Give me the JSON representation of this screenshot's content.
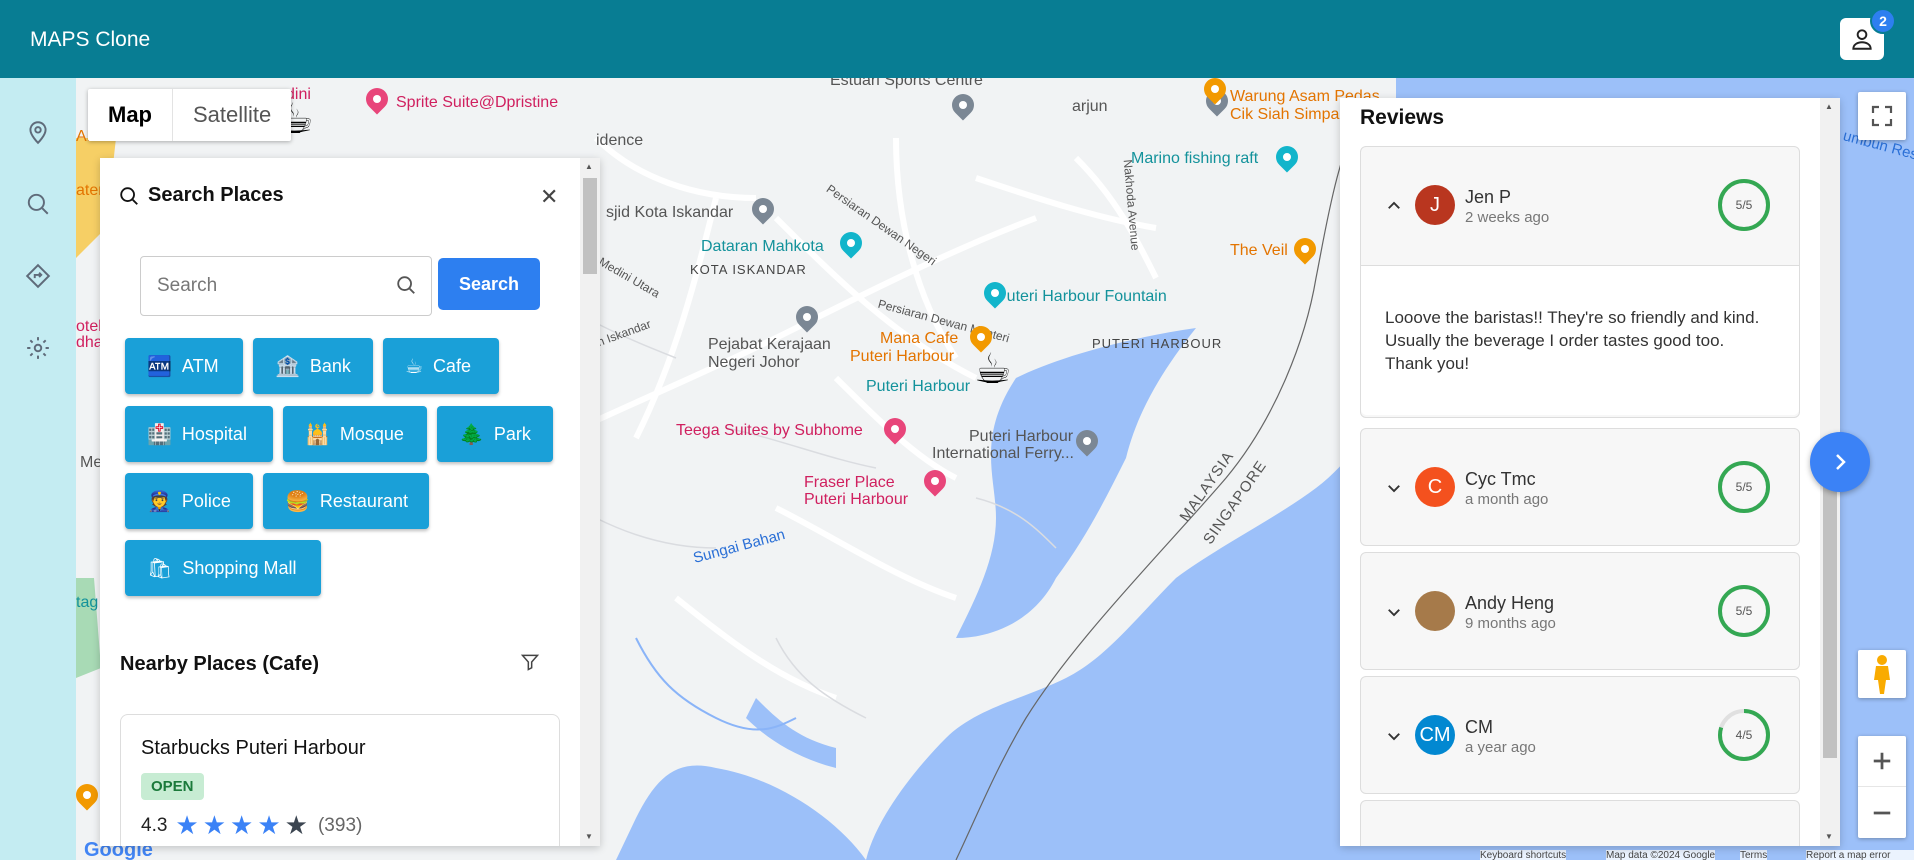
{
  "app": {
    "title": "MAPS Clone",
    "notification_count": "2"
  },
  "rail": {
    "items": [
      "location-icon",
      "search-icon",
      "directions-icon",
      "settings-icon"
    ]
  },
  "map": {
    "type_tabs": [
      "Map",
      "Satellite"
    ],
    "labels": {
      "estuari": "Estuari Sports Centre",
      "arjun": "arjun",
      "warung1": "Warung Asam Pedas",
      "warung2": "Cik Siah Simpang",
      "sprite": "Sprite Suite@Dpristine",
      "dini": "dini",
      "idence": "idence",
      "masjid": "sjid Kota Iskandar",
      "persiaran_dewan": "Persiaran Dewan Negeri",
      "nakhoda": "Nakhoda Avenue",
      "marino": "Marino fishing raft",
      "mahkota": "Dataran Mahkota",
      "kota_iskandar": "KOTA ISKANDAR",
      "medini": "h Medini Utara",
      "veil": "The Veil",
      "fountain": "Puteri Harbour Fountain",
      "persiaran_menteri": "Persiaran Dewan Menteri",
      "iskandar_road": "n Iskandar",
      "pejabat1": "Pejabat Kerajaan",
      "pejabat2": "Negeri Johor",
      "mana1": "Mana Cafe",
      "mana2": "Puteri Harbour",
      "puteri_harbour_area": "PUTERI HARBOUR",
      "puteri_harbour": "Puteri Harbour",
      "teega": "Teega Suites by Subhome",
      "ferry1": "Puteri Harbour",
      "ferry2": "International Ferry...",
      "fraser1": "Fraser Place",
      "fraser2": "Puteri Harbour",
      "malaysia": "MALAYSIA",
      "singapore": "SINGAPORE",
      "sungai": "Sungai Bahan",
      "rumbun": "umbun Rese",
      "otel": "otel",
      "dha": "dha",
      "ateri": "ateri",
      "and": "AND",
      "me": "Me",
      "tag": "tag"
    },
    "footer": [
      "Keyboard shortcuts",
      "Map data ©2024 Google",
      "Terms",
      "Report a map error"
    ],
    "brand": "Google"
  },
  "search_panel": {
    "title": "Search Places",
    "input_placeholder": "Search",
    "search_button": "Search",
    "categories": [
      {
        "label": "ATM",
        "icon": "🏧"
      },
      {
        "label": "Bank",
        "icon": "🏦"
      },
      {
        "label": "Cafe",
        "icon": "☕"
      },
      {
        "label": "Hospital",
        "icon": "🏥"
      },
      {
        "label": "Mosque",
        "icon": "🕌"
      },
      {
        "label": "Park",
        "icon": "🌲"
      },
      {
        "label": "Police",
        "icon": "👮"
      },
      {
        "label": "Restaurant",
        "icon": "🍔"
      },
      {
        "label": "Shopping Mall",
        "icon": "🛍"
      }
    ],
    "nearby_title": "Nearby Places (Cafe)",
    "place": {
      "name": "Starbucks Puteri Harbour",
      "status": "OPEN",
      "rating": "4.3",
      "stars": 4,
      "reviews": "(393)"
    }
  },
  "reviews": {
    "title": "Reviews",
    "items": [
      {
        "initial": "J",
        "name": "Jen P",
        "time": "2 weeks ago",
        "score": "5/5",
        "fraction": 1.0,
        "expanded": true,
        "text": "Looove the baristas!! They're so friendly and kind. Usually the beverage I order tastes good too. Thank you!",
        "color": "#b9361f"
      },
      {
        "initial": "C",
        "name": "Cyc Tmc",
        "time": "a month ago",
        "score": "5/5",
        "fraction": 1.0,
        "color": "#f4511e"
      },
      {
        "initial": "",
        "name": "Andy Heng",
        "time": "9 months ago",
        "score": "5/5",
        "fraction": 1.0,
        "color": "#a67a4a"
      },
      {
        "initial": "CM",
        "name": "CM",
        "time": "a year ago",
        "score": "4/5",
        "fraction": 0.8,
        "color": "#0288d1"
      }
    ]
  },
  "colors": {
    "header": "#087d93",
    "rail": "#c4ecf2",
    "chip": "#1aa0d8",
    "primary": "#2d7ff0",
    "water": "#9cc0f9",
    "score": "#34a853"
  }
}
